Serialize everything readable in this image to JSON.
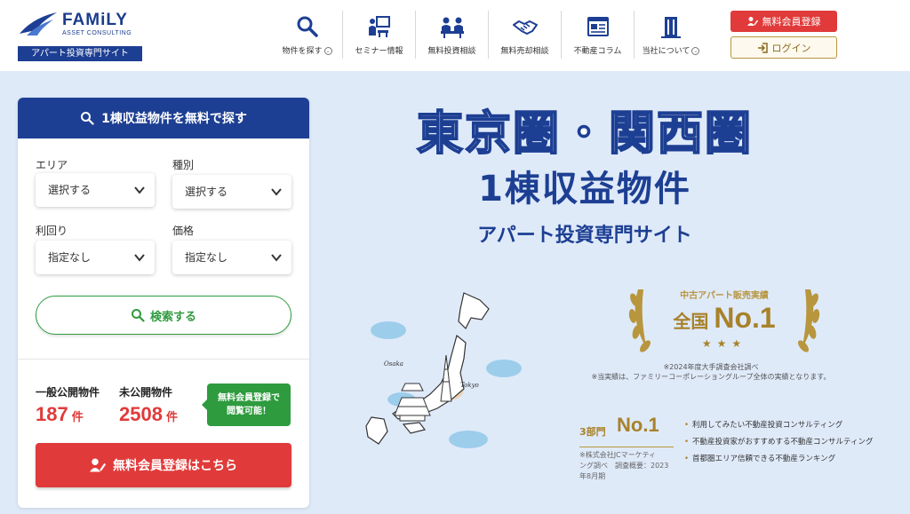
{
  "header": {
    "logo": {
      "name": "FAMiLY",
      "sub": "ASSET CONSULTING",
      "tag": "アパート投資専門サイト"
    },
    "nav": [
      {
        "label": "物件を探す",
        "icon": "search-icon",
        "has_dropdown": true
      },
      {
        "label": "セミナー情報",
        "icon": "seminar-icon",
        "has_dropdown": false
      },
      {
        "label": "無料投資相談",
        "icon": "consultation-icon",
        "has_dropdown": false
      },
      {
        "label": "無料売却相談",
        "icon": "handshake-icon",
        "has_dropdown": false
      },
      {
        "label": "不動産コラム",
        "icon": "column-icon",
        "has_dropdown": false
      },
      {
        "label": "当社について",
        "icon": "building-icon",
        "has_dropdown": true
      }
    ],
    "register_label": "無料会員登録",
    "login_label": "ログイン"
  },
  "search_panel": {
    "title": "1棟収益物件を無料で探す",
    "fields": {
      "area": {
        "label": "エリア",
        "value": "選択する"
      },
      "type": {
        "label": "種別",
        "value": "選択する"
      },
      "yield": {
        "label": "利回り",
        "value": "指定なし"
      },
      "price": {
        "label": "価格",
        "value": "指定なし"
      }
    },
    "search_label": "検索する",
    "stats": {
      "public_label": "一般公開物件",
      "public_count": "187",
      "private_label": "未公開物件",
      "private_count": "2508",
      "unit": "件"
    },
    "badge_line1": "無料会員登録で",
    "badge_line2": "閲覧可能！",
    "register_label": "無料会員登録はこちら"
  },
  "hero": {
    "title1": "東京圏・関西圏",
    "title2": "1棟収益物件",
    "title3": "アパート投資専門サイト",
    "map_labels": {
      "osaka": "Osaka",
      "tokyo": "Tokyo"
    },
    "award": {
      "top": "中古アパート販売実績",
      "main_prefix": "全国",
      "main": "No.1",
      "stars": "★★★",
      "note_line1": "※2024年度大手調査会社調べ",
      "note_line2": "※当実績は、ファミリーコーポレーショングループ全体の実績となります。"
    },
    "award2": {
      "prefix": "3部門",
      "main": "No.1",
      "note_line1": "※株式会社JCマーケティ",
      "note_line2": "ング調べ　調査概要：2023",
      "note_line3": "年8月期",
      "items": [
        "利用してみたい不動産投資コンサルティング",
        "不動産投資家がおすすめする不動産コンサルティング",
        "首都圏エリア信頼できる不動産ランキング"
      ]
    }
  },
  "colors": {
    "brand_blue": "#1d3f93",
    "accent_red": "#e13a3a",
    "accent_green": "#2e9b3e",
    "gold": "#a8822a",
    "background": "#dfeaf9"
  }
}
